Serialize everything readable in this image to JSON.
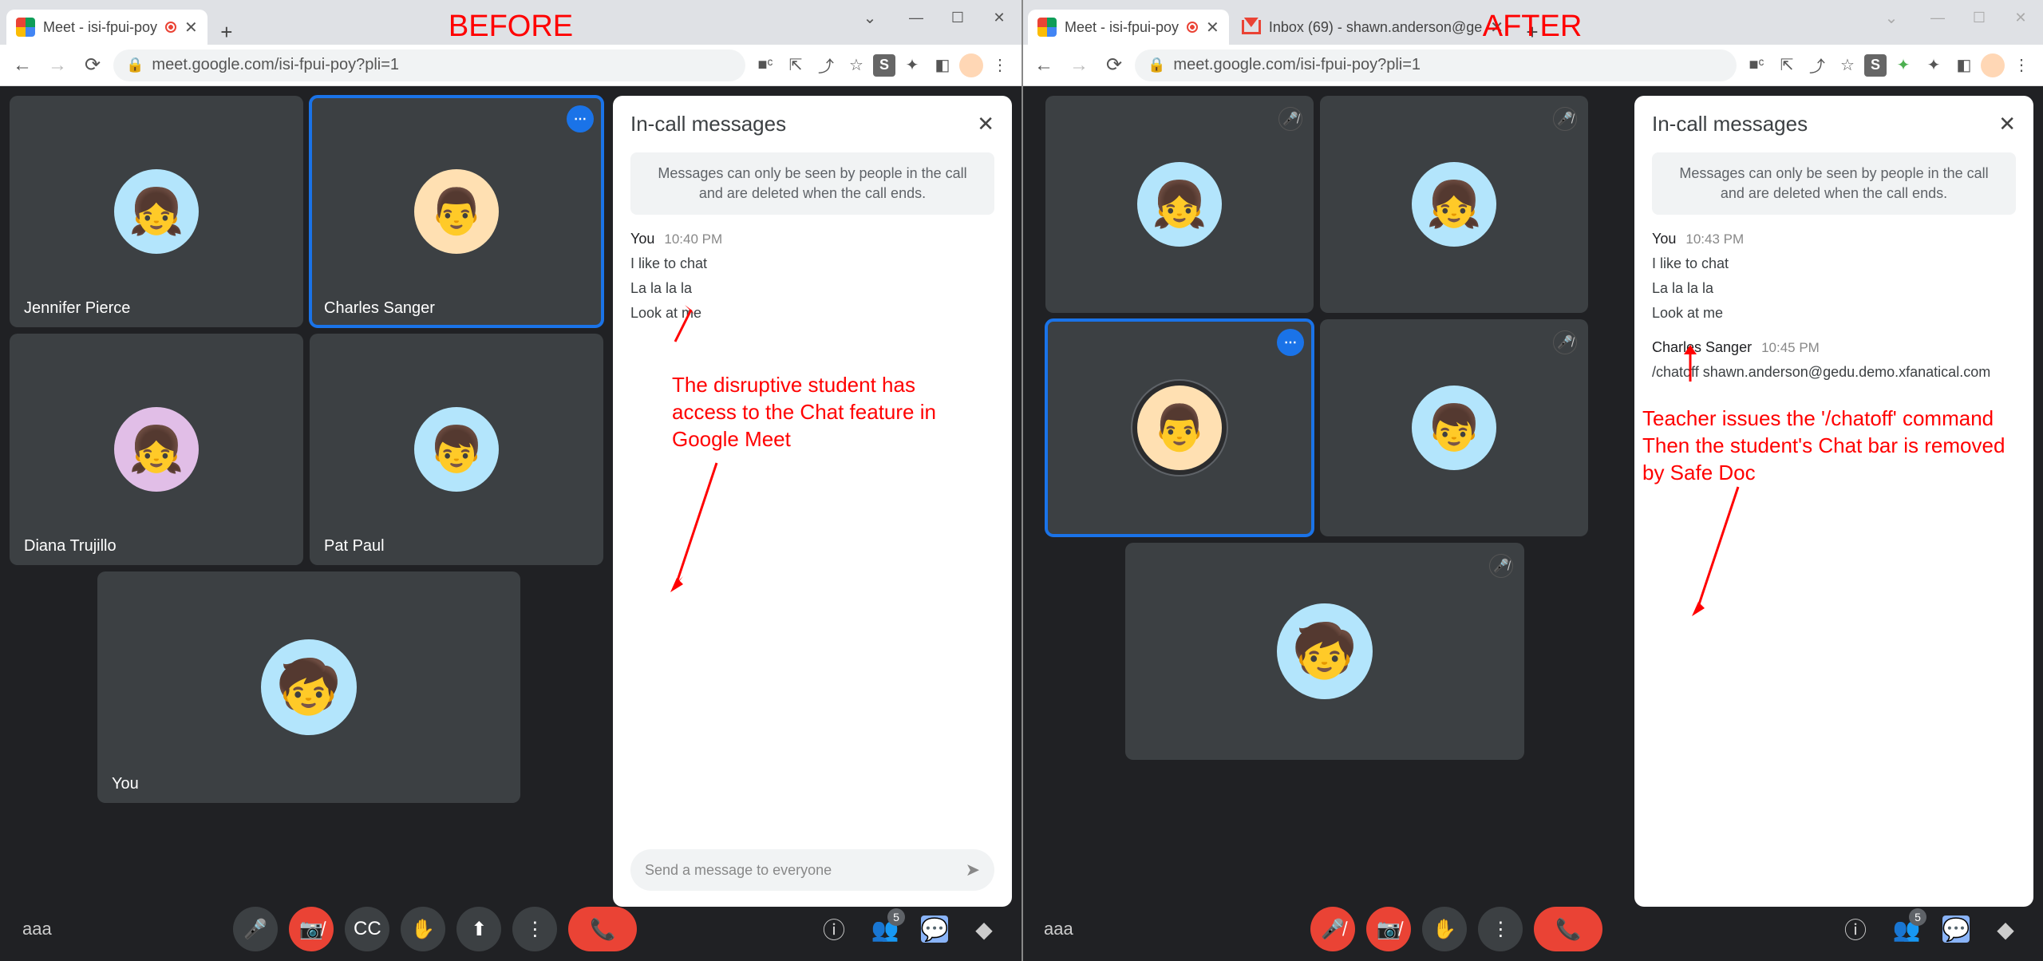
{
  "before_label": "BEFORE",
  "after_label": "AFTER",
  "tab": {
    "title": "Meet - isi-fpui-poy"
  },
  "tab2": {
    "title": "Inbox (69) - shawn.anderson@ge"
  },
  "url": "meet.google.com/isi-fpui-poy?pli=1",
  "chat": {
    "title": "In-call messages",
    "notice": "Messages can only be seen by people in the call and are deleted when the call ends.",
    "input_placeholder": "Send a message to everyone"
  },
  "before": {
    "participants": [
      {
        "name": "Jennifer Pierce",
        "color": "av-bg1",
        "emoji": "👧"
      },
      {
        "name": "Charles Sanger",
        "color": "av-bg2",
        "emoji": "👨",
        "active": true
      },
      {
        "name": "Diana Trujillo",
        "color": "av-bg3",
        "emoji": "👧"
      },
      {
        "name": "Pat Paul",
        "color": "av-bg1",
        "emoji": "👦"
      },
      {
        "name": "You",
        "color": "av-bg1",
        "emoji": "🧒",
        "large": true
      }
    ],
    "messages": [
      {
        "sender": "You",
        "time": "10:40 PM",
        "lines": [
          "I like to chat",
          "La la la la",
          "Look at me"
        ]
      }
    ],
    "annotation": "The disruptive student has access to the Chat feature in Google Meet",
    "people_count": "5",
    "code": "aaa"
  },
  "after": {
    "participants": [
      {
        "color": "av-bg1",
        "emoji": "👧",
        "muted": true
      },
      {
        "color": "av-bg1",
        "emoji": "👧",
        "muted": true
      },
      {
        "color": "av-bg2",
        "emoji": "👨",
        "active": true,
        "ring": true
      },
      {
        "color": "av-bg1",
        "emoji": "👦",
        "muted": true
      },
      {
        "color": "av-bg1",
        "emoji": "🧒",
        "large": true,
        "muted": true
      }
    ],
    "messages": [
      {
        "sender": "You",
        "time": "10:43 PM",
        "lines": [
          "I like to chat",
          "La la la la",
          "Look at me"
        ]
      },
      {
        "sender": "Charles Sanger",
        "time": "10:45 PM",
        "lines": [
          "/chatoff shawn.anderson@gedu.demo.xfanatical.com"
        ]
      }
    ],
    "annotation": "Teacher issues the '/chatoff' command\nThen the student's Chat bar is removed by Safe Doc",
    "people_count": "5",
    "code": "aaa"
  }
}
